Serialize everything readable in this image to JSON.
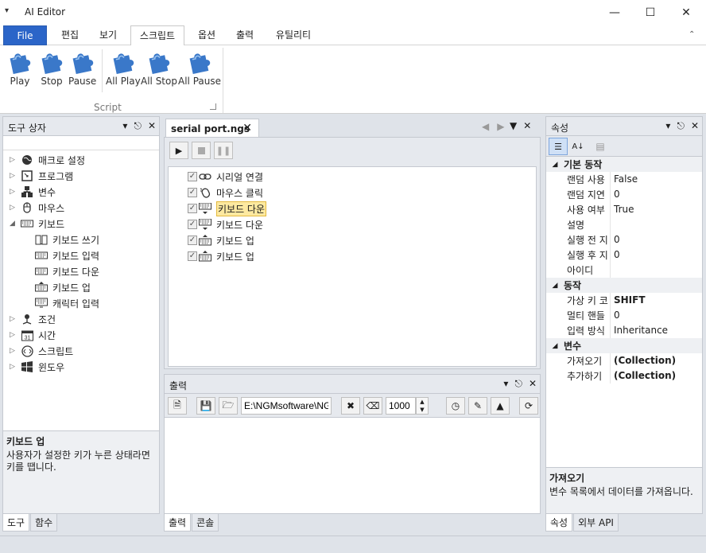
{
  "window": {
    "title": "AI Editor",
    "controls": [
      "minimize",
      "maximize",
      "close"
    ]
  },
  "ribbon": {
    "tabs": [
      {
        "label": "File"
      },
      {
        "label": "편집"
      },
      {
        "label": "보기"
      },
      {
        "label": "스크립트"
      },
      {
        "label": "옵션"
      },
      {
        "label": "출력"
      },
      {
        "label": "유틸리티"
      }
    ],
    "active_tab": "스크립트",
    "group_label": "Script",
    "buttons": [
      {
        "label": "Play",
        "icon": "puzzle-icon"
      },
      {
        "label": "Stop",
        "icon": "puzzle-icon"
      },
      {
        "label": "Pause",
        "icon": "puzzle-icon"
      },
      {
        "label": "All Play",
        "icon": "puzzle-icon"
      },
      {
        "label": "All Stop",
        "icon": "puzzle-icon"
      },
      {
        "label": "All Pause",
        "icon": "puzzle-icon"
      }
    ]
  },
  "toolbox": {
    "title": "도구 상자",
    "items": [
      {
        "label": "매크로 설정",
        "icon": "globe-icon"
      },
      {
        "label": "프로그램",
        "icon": "program-icon"
      },
      {
        "label": "변수",
        "icon": "variable-icon"
      },
      {
        "label": "마우스",
        "icon": "mouse-icon"
      },
      {
        "label": "키보드",
        "icon": "keyboard-icon"
      },
      {
        "label": "키보드 쓰기",
        "icon": "book-icon"
      },
      {
        "label": "키보드 입력",
        "icon": "keyboard-icon"
      },
      {
        "label": "키보드 다운",
        "icon": "keyboard-icon"
      },
      {
        "label": "키보드 업",
        "icon": "keyboard-icon"
      },
      {
        "label": "캐릭터 입력",
        "icon": "keyboard-icon"
      },
      {
        "label": "조건",
        "icon": "condition-icon"
      },
      {
        "label": "시간",
        "icon": "calendar-icon"
      },
      {
        "label": "스크립트",
        "icon": "script-icon"
      },
      {
        "label": "윈도우",
        "icon": "windows-icon"
      }
    ],
    "calendar_number": "31",
    "description_title": "키보드 업",
    "description_text": "사용자가 설정한 키가 누른 상태라면 키를 땝니다.",
    "bottom_tabs": [
      "도구",
      "함수"
    ]
  },
  "document": {
    "tab_label": "serial port.ngs",
    "script_items": [
      {
        "label": "시리얼 연결",
        "checked": true,
        "icon": "link-icon"
      },
      {
        "label": "마우스 클릭",
        "checked": true,
        "icon": "mouse-click-icon"
      },
      {
        "label": "키보드 다운",
        "checked": true,
        "icon": "keyboard-down-icon",
        "selected": true
      },
      {
        "label": "키보드 다운",
        "checked": true,
        "icon": "keyboard-down-icon"
      },
      {
        "label": "키보드 업",
        "checked": true,
        "icon": "keyboard-up-icon"
      },
      {
        "label": "키보드 업",
        "checked": true,
        "icon": "keyboard-up-icon"
      }
    ]
  },
  "output": {
    "title": "출력",
    "path": "E:\\NGMsoftware\\NG",
    "count": "1000",
    "bottom_tabs": [
      "출력",
      "콘솔"
    ]
  },
  "properties": {
    "title": "속성",
    "categories": [
      {
        "name": "기본 동작",
        "rows": [
          {
            "name": "랜덤 사용",
            "value": "False"
          },
          {
            "name": "랜덤 지연",
            "value": "0"
          },
          {
            "name": "사용 여부",
            "value": "True"
          },
          {
            "name": "설명",
            "value": ""
          },
          {
            "name": "실행 전 지",
            "value": "0"
          },
          {
            "name": "실행 후 지",
            "value": "0"
          },
          {
            "name": "아이디",
            "value": ""
          }
        ]
      },
      {
        "name": "동작",
        "rows": [
          {
            "name": "가상 키 코",
            "value": "SHIFT"
          },
          {
            "name": "멀티 핸들",
            "value": "0"
          },
          {
            "name": "입력 방식",
            "value": "Inheritance"
          }
        ]
      },
      {
        "name": "변수",
        "rows": [
          {
            "name": "가져오기",
            "value": "(Collection)"
          },
          {
            "name": "추가하기",
            "value": "(Collection)"
          }
        ]
      }
    ],
    "description_title": "가져오기",
    "description_text": "변수 목록에서 데이터를 가져옵니다.",
    "bottom_tabs": [
      "속성",
      "외부 API"
    ]
  },
  "colors": {
    "file_tab": "#2b65c8",
    "puzzle": "#3a78c9",
    "selected_item": "#fde9a0",
    "panel_bg": "#dfe3e9"
  }
}
